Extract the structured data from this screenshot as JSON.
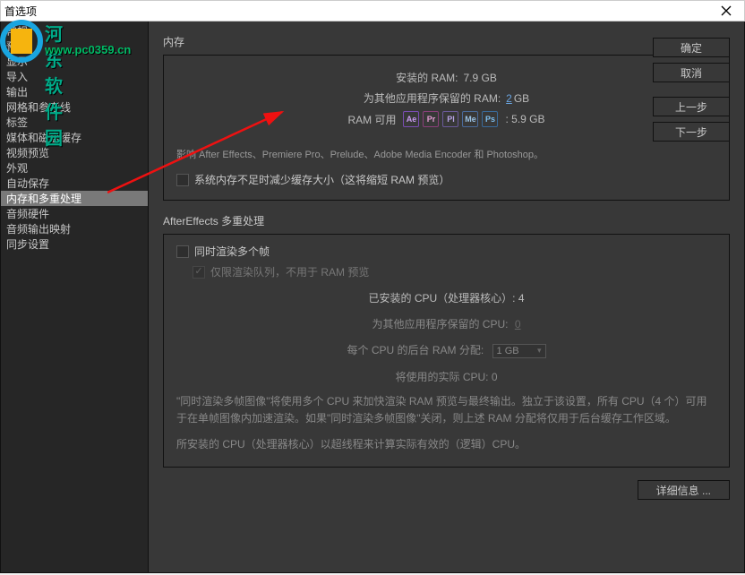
{
  "titlebar": {
    "title": "首选项"
  },
  "sidebar": {
    "items": [
      {
        "label": "常规"
      },
      {
        "label": "预览"
      },
      {
        "label": "显示"
      },
      {
        "label": "导入"
      },
      {
        "label": "输出"
      },
      {
        "label": "网格和参考线"
      },
      {
        "label": "标签"
      },
      {
        "label": "媒体和磁盘缓存"
      },
      {
        "label": "视频预览"
      },
      {
        "label": "外观"
      },
      {
        "label": "自动保存"
      },
      {
        "label": "内存和多重处理",
        "selected": true
      },
      {
        "label": "音频硬件"
      },
      {
        "label": "音频输出映射"
      },
      {
        "label": "同步设置"
      }
    ]
  },
  "buttons": {
    "ok": "确定",
    "cancel": "取消",
    "prev": "上一步",
    "next": "下一步",
    "details": "详细信息 ..."
  },
  "memory": {
    "heading": "内存",
    "installed_label": "安装的 RAM:",
    "installed_value": "7.9 GB",
    "reserved_label": "为其他应用程序保留的 RAM:",
    "reserved_value": "2",
    "reserved_unit": "GB",
    "available_label": "RAM 可用",
    "available_value": ": 5.9 GB",
    "note": "影响 After Effects、Premiere Pro、Prelude、Adobe Media Encoder 和 Photoshop。",
    "checkbox_label": "系统内存不足时减少缓存大小（这将缩短 RAM 预览）",
    "icons": [
      "Ae",
      "Pr",
      "Pl",
      "Me",
      "Ps"
    ]
  },
  "multi": {
    "heading": "AfterEffects 多重处理",
    "cb1": "同时渲染多个帧",
    "cb2": "仅限渲染队列，不用于 RAM 预览",
    "cpu_installed_label": "已安装的 CPU（处理器核心）: 4",
    "cpu_reserved_label": "为其他应用程序保留的 CPU:",
    "cpu_reserved_value": "0",
    "ram_per_cpu_label": "每个 CPU 的后台 RAM 分配:",
    "ram_per_cpu_value": "1 GB",
    "actual_cpu_label": "将使用的实际 CPU: 0",
    "desc1": "\"同时渲染多帧图像\"将使用多个 CPU 来加快渲染 RAM 预览与最终输出。独立于该设置，所有 CPU（4 个）可用于在单帧图像内加速渲染。如果\"同时渲染多帧图像\"关闭，则上述 RAM 分配将仅用于后台缓存工作区域。",
    "desc2": "所安装的 CPU（处理器核心）以超线程来计算实际有效的（逻辑）CPU。"
  },
  "watermark": {
    "text": "河东软件园",
    "url": "www.pc0359.cn"
  }
}
